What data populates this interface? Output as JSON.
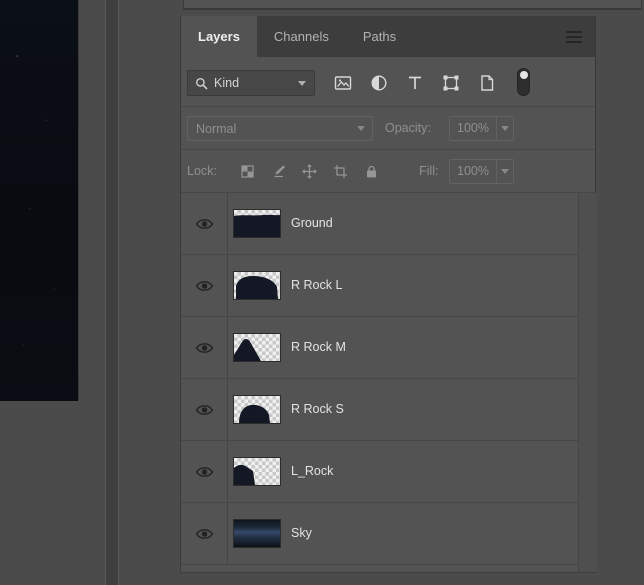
{
  "tabs": {
    "items": [
      {
        "label": "Layers",
        "active": true
      },
      {
        "label": "Channels",
        "active": false
      },
      {
        "label": "Paths",
        "active": false
      }
    ]
  },
  "filter": {
    "kind_label": "Kind",
    "icons": [
      "search-icon",
      "pixel-layer-filter-icon",
      "adjustment-layer-filter-icon",
      "type-layer-filter-icon",
      "shape-layer-filter-icon",
      "smart-object-filter-icon",
      "filter-toggle-pill"
    ]
  },
  "blend": {
    "mode_value": "Normal",
    "opacity_label": "Opacity:",
    "opacity_value": "100%"
  },
  "lock": {
    "label": "Lock:",
    "icons": [
      "lock-transparency-icon",
      "lock-image-icon",
      "lock-position-icon",
      "lock-artboard-icon",
      "lock-all-icon"
    ],
    "fill_label": "Fill:",
    "fill_value": "100%"
  },
  "layers": [
    {
      "name": "Ground",
      "visible": true
    },
    {
      "name": "R Rock L",
      "visible": true
    },
    {
      "name": "R Rock M",
      "visible": true
    },
    {
      "name": "R Rock S",
      "visible": true
    },
    {
      "name": "L_Rock",
      "visible": true
    },
    {
      "name": "Sky",
      "visible": true
    }
  ],
  "colors": {
    "panel_bg": "#535353",
    "tabbar_bg": "#3d3d3d",
    "canvas_bg": "#090c11",
    "disabled_text": "#8f8f8f",
    "label_text": "#e3e3e3",
    "thumb_shape": "#141824"
  }
}
